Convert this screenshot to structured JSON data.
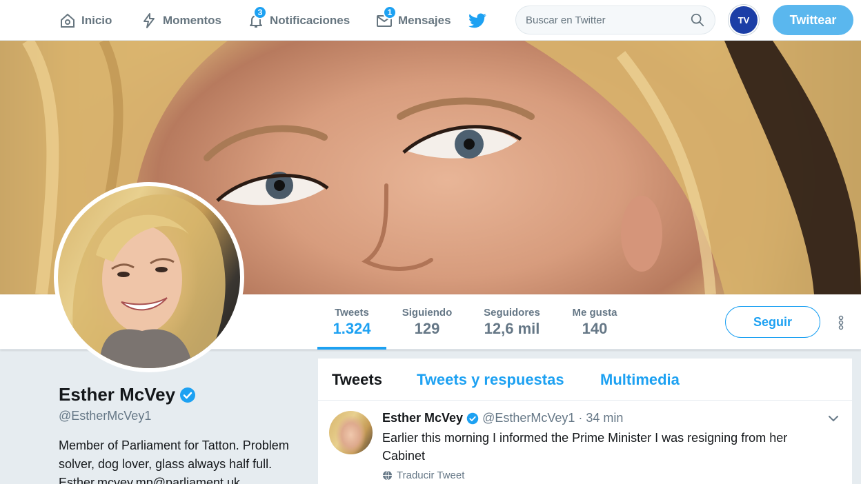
{
  "nav": {
    "home_label": "Inicio",
    "moments_label": "Momentos",
    "notifications_label": "Notificaciones",
    "notifications_count": "3",
    "messages_label": "Mensajes",
    "messages_count": "1",
    "search_placeholder": "Buscar en Twitter",
    "avatar_label": "TV",
    "tweet_button": "Twittear"
  },
  "profile": {
    "name": "Esther McVey",
    "handle": "@EstherMcVey1",
    "bio": "Member of Parliament for Tatton. Problem solver, dog lover, glass always half full. Esther.mcvey.mp@parliament.uk",
    "follow_button": "Seguir"
  },
  "stats": [
    {
      "label": "Tweets",
      "value": "1.324"
    },
    {
      "label": "Siguiendo",
      "value": "129"
    },
    {
      "label": "Seguidores",
      "value": "12,6 mil"
    },
    {
      "label": "Me gusta",
      "value": "140"
    }
  ],
  "timeline_tabs": [
    {
      "label": "Tweets"
    },
    {
      "label": "Tweets y respuestas"
    },
    {
      "label": "Multimedia"
    }
  ],
  "tweet": {
    "name": "Esther McVey",
    "handle": "@EstherMcVey1",
    "separator": "·",
    "time": "34 min",
    "text": "Earlier this morning I informed the Prime Minister I was resigning from her Cabinet",
    "translate": "Traducir Tweet"
  },
  "colors": {
    "accent": "#1da1f2",
    "tweet_button_bg": "#5ab7ee",
    "background": "#e6ecf0"
  }
}
